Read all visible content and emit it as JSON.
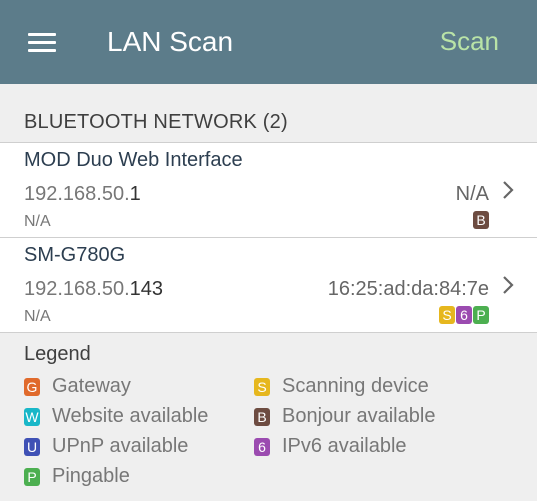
{
  "header": {
    "menu_icon": "hamburger-menu-icon",
    "title": "LAN Scan",
    "scan_label": "Scan"
  },
  "section": {
    "title": "BLUETOOTH NETWORK (2)"
  },
  "devices": [
    {
      "name": "MOD Duo Web Interface",
      "ip_prefix": "192.168.50.",
      "ip_last": "1",
      "mac": "N/A",
      "vendor": "N/A",
      "badges": [
        {
          "letter": "B",
          "color": "#6d4c41"
        }
      ]
    },
    {
      "name": "SM-G780G",
      "ip_prefix": "192.168.50.",
      "ip_last": "143",
      "mac": "16:25:ad:da:84:7e",
      "vendor": "N/A",
      "badges": [
        {
          "letter": "S",
          "color": "#e6b71e"
        },
        {
          "letter": "6",
          "color": "#9b4bb0"
        },
        {
          "letter": "P",
          "color": "#4caf50"
        }
      ]
    }
  ],
  "legend": {
    "title": "Legend",
    "items": [
      {
        "letter": "G",
        "label": "Gateway",
        "color": "#e06a2c"
      },
      {
        "letter": "S",
        "label": "Scanning device",
        "color": "#e6b71e"
      },
      {
        "letter": "W",
        "label": "Website available",
        "color": "#19b7c8"
      },
      {
        "letter": "B",
        "label": "Bonjour available",
        "color": "#6d4c41"
      },
      {
        "letter": "U",
        "label": "UPnP available",
        "color": "#3f51b5"
      },
      {
        "letter": "6",
        "label": "IPv6 available",
        "color": "#9b4bb0"
      },
      {
        "letter": "P",
        "label": "Pingable",
        "color": "#4caf50"
      }
    ]
  }
}
